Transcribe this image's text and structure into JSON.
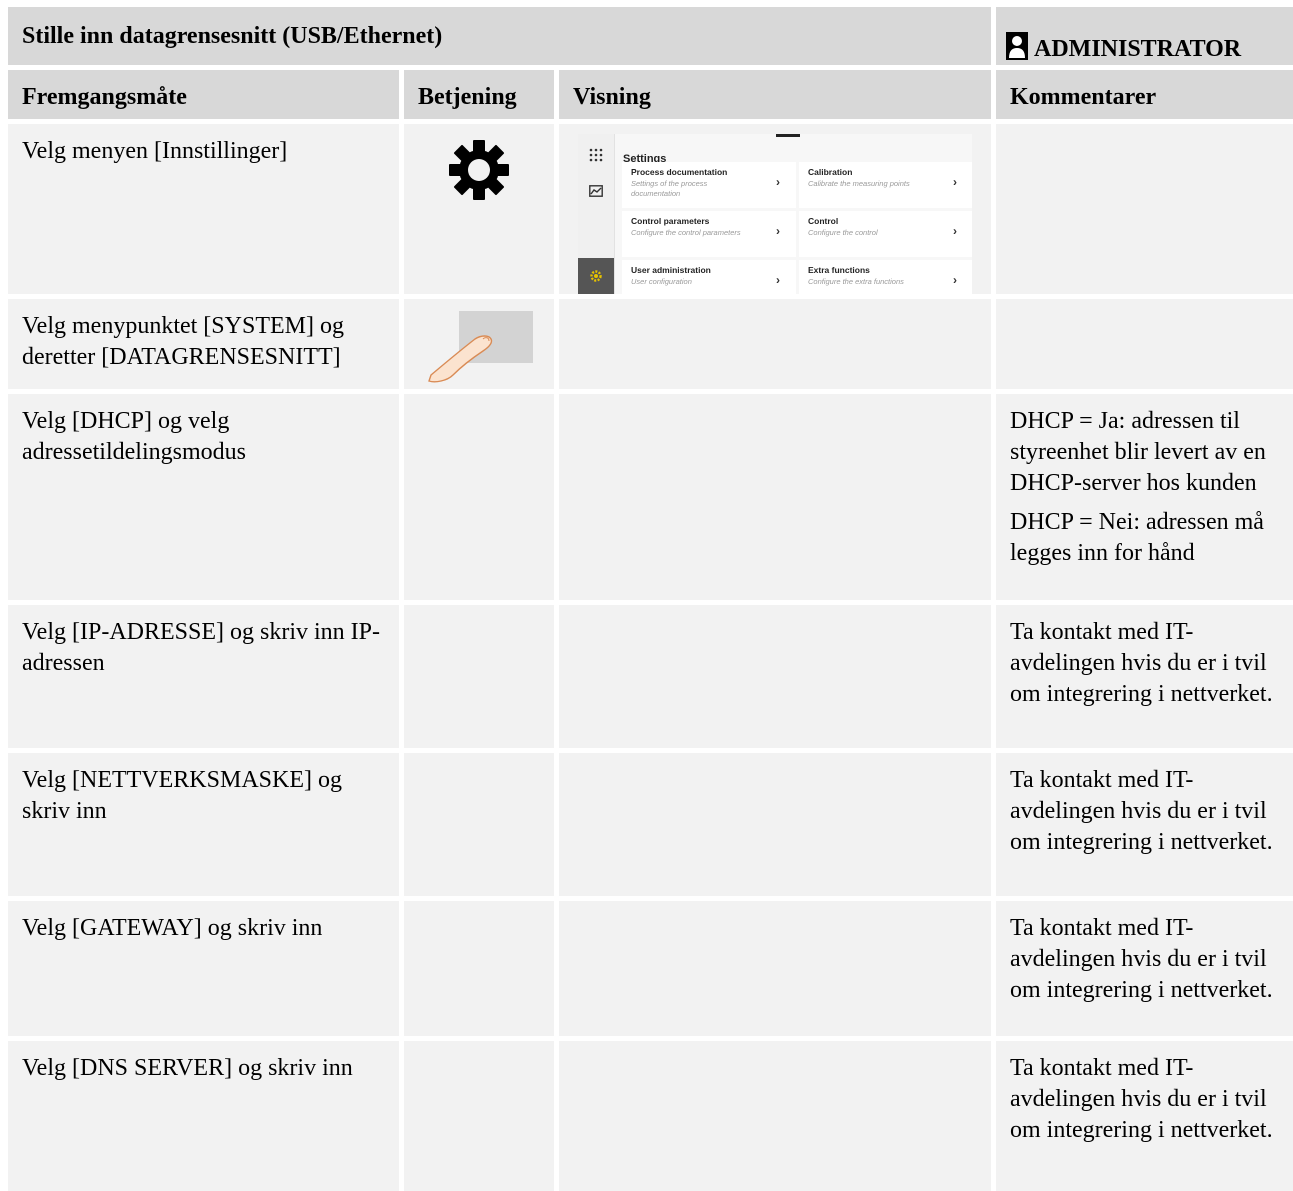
{
  "title": "Stille inn datagrensesnitt (USB/Ethernet)",
  "role": "ADMINISTRATOR",
  "columns": {
    "procedure": "Fremgangsmåte",
    "operation": "Betjening",
    "display": "Visning",
    "comments": "Kommentarer"
  },
  "rows": [
    {
      "procedure": "Velg menyen [Innstillinger]",
      "operation_icon": "gear-icon",
      "comments": []
    },
    {
      "procedure": "Velg menypunktet [SYSTEM] og deretter [DATAGRENSESNITT]",
      "operation_icon": "touch-finger-icon",
      "comments": []
    },
    {
      "procedure": "Velg [DHCP] og velg adressetildelingsmodus",
      "comments": [
        "DHCP = Ja: adressen til styreenhet blir levert av en DHCP-server hos kunden",
        "DHCP = Nei: adressen må legges inn for hånd"
      ]
    },
    {
      "procedure": "Velg [IP-ADRESSE] og skriv inn IP-adressen",
      "comments": [
        "Ta kontakt med IT-avdelingen hvis du er i tvil om integrering i nettverket."
      ]
    },
    {
      "procedure": "Velg [NETTVERKSMASKE] og skriv inn",
      "comments": [
        "Ta kontakt med IT-avdelingen hvis du er i tvil om integrering i nettverket."
      ]
    },
    {
      "procedure": "Velg [GATEWAY] og skriv inn",
      "comments": [
        "Ta kontakt med IT-avdelingen hvis du er i tvil om integrering i nettverket."
      ]
    },
    {
      "procedure": "Velg [DNS SERVER] og skriv inn",
      "comments": [
        "Ta kontakt med IT-avdelingen hvis du er i tvil om integrering i nettverket."
      ]
    }
  ],
  "settings_screen": {
    "title": "Settings",
    "tiles": [
      {
        "title": "Process documentation",
        "subtitle": "Settings of the process documentation"
      },
      {
        "title": "Calibration",
        "subtitle": "Calibrate the measuring points"
      },
      {
        "title": "Control parameters",
        "subtitle": "Configure the control parameters"
      },
      {
        "title": "Control",
        "subtitle": "Configure the control"
      },
      {
        "title": "User administration",
        "subtitle": "User configuration"
      },
      {
        "title": "Extra functions",
        "subtitle": "Configure the extra functions"
      }
    ]
  }
}
